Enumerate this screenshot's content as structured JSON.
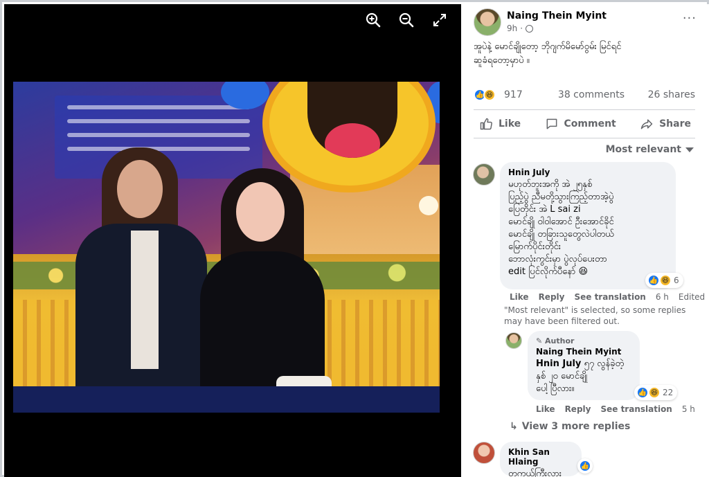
{
  "viewer": {
    "tools": [
      "zoom-in",
      "zoom-out",
      "fullscreen"
    ]
  },
  "post": {
    "author": "Naing Thein Myint",
    "time": "9h",
    "more": "···",
    "text_line1": "အူပဲနဲ့ မောင်ချိုတော့ ဘိုဂျက်မိမော်ဝွမ်း မြင်ရင်",
    "text_line2": "ဆူခံရတော့မှာပဲ ။",
    "reaction_count": "917",
    "comments_count": "38 comments",
    "shares_count": "26 shares"
  },
  "actions": {
    "like": "Like",
    "comment": "Comment",
    "share": "Share"
  },
  "sort_label": "Most relevant",
  "comments": [
    {
      "name": "Hnin July",
      "lines": [
        "မဟုတ်ဘူးအကို အဲ ၂၅နှစ်",
        "ပြည့်ပွဲ ညီမတို့သွားကြည့်တာအဲ့ပွဲ",
        "ပြေတိုင်း အဲ L sai zi",
        "မောင်ချို ဝါဝါအောင် ဦးအောင်ခိုင်",
        "မောင်ချို တခြားသူတွေလဲပါတယ်",
        "မြောက်ပိုင်းတိုင်း",
        "ဘောလုံးကွင်းမှာ ပွဲလုပ်ပေးတာ",
        "edit ပြင်လိုက်ပီနော် 😆"
      ],
      "reaction_count": "6",
      "like": "Like",
      "reply": "Reply",
      "translate": "See translation",
      "time": "6 h",
      "edited": "Edited"
    }
  ],
  "filter_note": "\"Most relevant\" is selected, so some replies may have been filtered out.",
  "reply": {
    "author_tag": "Author",
    "name": "Naing Thein Myint",
    "mention": "Hnin July",
    "text_rest": " ၅၇ လွန်ခဲ့တဲ့",
    "line2": "နှစ် ၂၀ မောင်ချို",
    "line3": "ပေါ့ ပြီလား။",
    "reaction_count": "22",
    "like": "Like",
    "reply": "Reply",
    "translate": "See translation",
    "time": "5 h"
  },
  "view_more": "View 3 more replies",
  "comment2": {
    "name": "Khin San Hlaing",
    "text": "တကယ်ကြီးလား"
  },
  "colors": {
    "accent": "#1877f2",
    "haha": "#f7b928",
    "muted": "#65676b",
    "bubble": "#f0f2f5"
  }
}
